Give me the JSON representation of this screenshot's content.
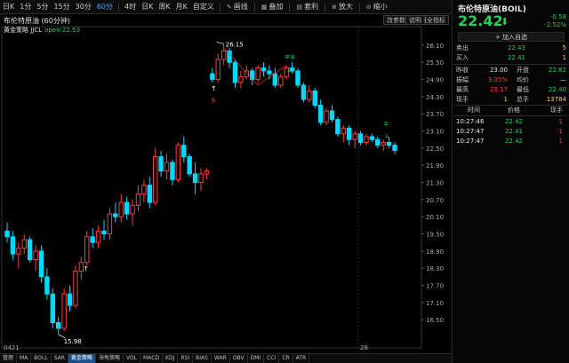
{
  "toolbar": {
    "periods": [
      "日K",
      "1分",
      "5分",
      "15分",
      "30分",
      "60分",
      "4时",
      "日K",
      "周K",
      "月K",
      "自定义"
    ],
    "active_index": 5,
    "tools": [
      {
        "icon": "pen-icon",
        "label": "画线"
      },
      {
        "icon": "overlay-icon",
        "label": "叠加"
      },
      {
        "icon": "template-icon",
        "label": "套利"
      },
      {
        "icon": "zoom-in-icon",
        "label": "放大"
      },
      {
        "icon": "zoom-out-icon",
        "label": "缩小"
      }
    ]
  },
  "chart": {
    "title": "布伦特原油 (60分钟)",
    "buttons": [
      "改参数",
      "隐藏全指标",
      "说明"
    ],
    "strategy_name": "黄金策略 JJCL",
    "strategy_value": "open:22.53",
    "x_labels": [
      "0421",
      "28"
    ],
    "annotations": {
      "high": "26.15",
      "low": "15.98",
      "buy1": "平多",
      "buy2": "平"
    }
  },
  "chart_data": {
    "type": "candlestick",
    "y_ticks": [
      26.1,
      25.5,
      24.9,
      24.3,
      23.7,
      23.1,
      22.5,
      21.9,
      21.3,
      20.7,
      20.1,
      19.5,
      18.9,
      18.3,
      17.7,
      17.1,
      16.5
    ],
    "ylim": [
      15.7,
      26.5
    ],
    "colors": {
      "up": "#ff3b3b",
      "down": "#00d8ff"
    },
    "candles": [
      [
        19.6,
        19.9,
        19.2,
        19.4
      ],
      [
        19.4,
        19.6,
        18.6,
        18.8
      ],
      [
        18.8,
        19.2,
        18.3,
        19.0
      ],
      [
        19.0,
        19.5,
        18.8,
        19.3
      ],
      [
        19.3,
        19.4,
        18.5,
        18.6
      ],
      [
        18.6,
        19.1,
        18.2,
        18.9
      ],
      [
        18.9,
        19.1,
        17.8,
        18.0
      ],
      [
        18.0,
        18.3,
        17.2,
        17.4
      ],
      [
        17.4,
        17.6,
        16.2,
        16.4
      ],
      [
        16.4,
        16.6,
        15.98,
        16.2
      ],
      [
        16.2,
        17.6,
        16.1,
        17.4
      ],
      [
        17.4,
        17.7,
        16.8,
        17.0
      ],
      [
        17.0,
        18.4,
        16.9,
        18.2
      ],
      [
        18.2,
        18.7,
        17.9,
        18.5
      ],
      [
        18.5,
        19.6,
        18.4,
        19.4
      ],
      [
        19.4,
        19.7,
        19.0,
        19.2
      ],
      [
        19.2,
        19.8,
        19.0,
        19.6
      ],
      [
        19.6,
        20.0,
        19.3,
        19.5
      ],
      [
        19.5,
        20.4,
        19.3,
        20.2
      ],
      [
        20.2,
        20.6,
        19.9,
        20.1
      ],
      [
        20.1,
        20.9,
        19.9,
        20.6
      ],
      [
        20.6,
        20.8,
        20.0,
        20.2
      ],
      [
        20.2,
        20.7,
        19.8,
        20.5
      ],
      [
        20.5,
        21.2,
        20.3,
        20.9
      ],
      [
        20.9,
        21.4,
        20.6,
        21.2
      ],
      [
        21.2,
        21.5,
        20.4,
        20.6
      ],
      [
        20.6,
        22.5,
        20.5,
        22.2
      ],
      [
        22.2,
        22.4,
        21.5,
        21.7
      ],
      [
        21.7,
        22.3,
        21.4,
        22.0
      ],
      [
        22.0,
        22.1,
        21.2,
        21.4
      ],
      [
        21.4,
        22.7,
        21.3,
        22.6
      ],
      [
        22.6,
        22.9,
        22.0,
        22.2
      ],
      [
        22.2,
        22.3,
        21.5,
        21.6
      ],
      [
        21.6,
        22.0,
        20.9,
        21.3
      ],
      [
        21.3,
        21.8,
        21.0,
        21.6
      ],
      [
        21.6,
        21.8,
        21.4,
        21.7
      ],
      [
        25.1,
        25.3,
        24.8,
        24.9
      ],
      [
        24.9,
        25.8,
        24.8,
        25.6
      ],
      [
        25.6,
        26.15,
        25.4,
        25.9
      ],
      [
        25.9,
        26.0,
        25.3,
        25.5
      ],
      [
        25.5,
        25.6,
        24.6,
        24.8
      ],
      [
        24.8,
        25.2,
        24.6,
        25.0
      ],
      [
        25.0,
        25.4,
        24.9,
        25.2
      ],
      [
        25.2,
        25.3,
        24.7,
        24.9
      ],
      [
        24.9,
        25.4,
        24.8,
        25.3
      ],
      [
        25.3,
        25.5,
        25.0,
        25.2
      ],
      [
        25.2,
        25.4,
        24.9,
        25.1
      ],
      [
        25.1,
        25.3,
        24.6,
        24.7
      ],
      [
        24.7,
        25.1,
        24.6,
        25.0
      ],
      [
        25.0,
        25.4,
        24.9,
        25.3
      ],
      [
        25.3,
        25.5,
        25.1,
        25.2
      ],
      [
        25.2,
        25.3,
        24.6,
        24.7
      ],
      [
        24.7,
        24.8,
        24.1,
        24.2
      ],
      [
        24.2,
        24.7,
        24.1,
        24.5
      ],
      [
        24.5,
        24.6,
        23.9,
        24.0
      ],
      [
        24.0,
        24.2,
        23.3,
        23.4
      ],
      [
        23.4,
        23.9,
        23.3,
        23.8
      ],
      [
        23.8,
        24.0,
        23.4,
        23.5
      ],
      [
        23.5,
        23.6,
        22.9,
        23.0
      ],
      [
        23.0,
        23.3,
        22.7,
        23.2
      ],
      [
        23.2,
        23.3,
        22.6,
        22.8
      ],
      [
        22.8,
        23.1,
        22.5,
        23.0
      ],
      [
        23.0,
        23.1,
        22.6,
        22.7
      ],
      [
        22.7,
        23.0,
        22.6,
        22.9
      ],
      [
        22.9,
        23.0,
        22.7,
        22.8
      ],
      [
        22.8,
        22.9,
        22.5,
        22.6
      ],
      [
        22.6,
        22.8,
        22.4,
        22.7
      ],
      [
        22.7,
        22.9,
        22.5,
        22.6
      ],
      [
        22.6,
        22.7,
        22.3,
        22.42
      ]
    ]
  },
  "panel": {
    "name": "布伦特原油(BOIL)",
    "price": "22.42",
    "arrow": "⬇",
    "change": "-0.58",
    "change_pct": "-2.52%",
    "add_label": "+ 加入自选",
    "sell": {
      "label": "卖出",
      "price": "22.43",
      "qty": "5"
    },
    "buy": {
      "label": "买入",
      "price": "22.41",
      "qty": "1"
    },
    "stats": [
      {
        "l1": "昨收",
        "v1": "23.00",
        "c1": "white",
        "l2": "开盘",
        "v2": "22.82",
        "c2": "green"
      },
      {
        "l1": "振幅",
        "v1": "3.35%",
        "c1": "red",
        "l2": "均价",
        "v2": "—",
        "c2": "white"
      },
      {
        "l1": "最高",
        "v1": "23.17",
        "c1": "red",
        "l2": "最低",
        "v2": "22.40",
        "c2": "green"
      },
      {
        "l1": "现手",
        "v1": "1",
        "c1": "yellow",
        "l2": "总手",
        "v2": "13784",
        "c2": "yellow"
      }
    ],
    "trade_headers": [
      "时间",
      "价格",
      "现手"
    ],
    "trades": [
      {
        "time": "10:27:46",
        "price": "22.42",
        "qty": "1"
      },
      {
        "time": "10:27:47",
        "price": "22.41",
        "qty": "1"
      },
      {
        "time": "10:27:47",
        "price": "22.42",
        "qty": "1"
      }
    ]
  },
  "bottom_tabs": [
    "管理",
    "MA",
    "BOLL",
    "SAR",
    "黄金策略",
    "海龟策略",
    "VOL",
    "MACD",
    "KDJ",
    "RSI",
    "BIAS",
    "WAR",
    "OBV",
    "DMI",
    "CCI",
    "CR",
    "ATR"
  ],
  "bottom_active": 4
}
